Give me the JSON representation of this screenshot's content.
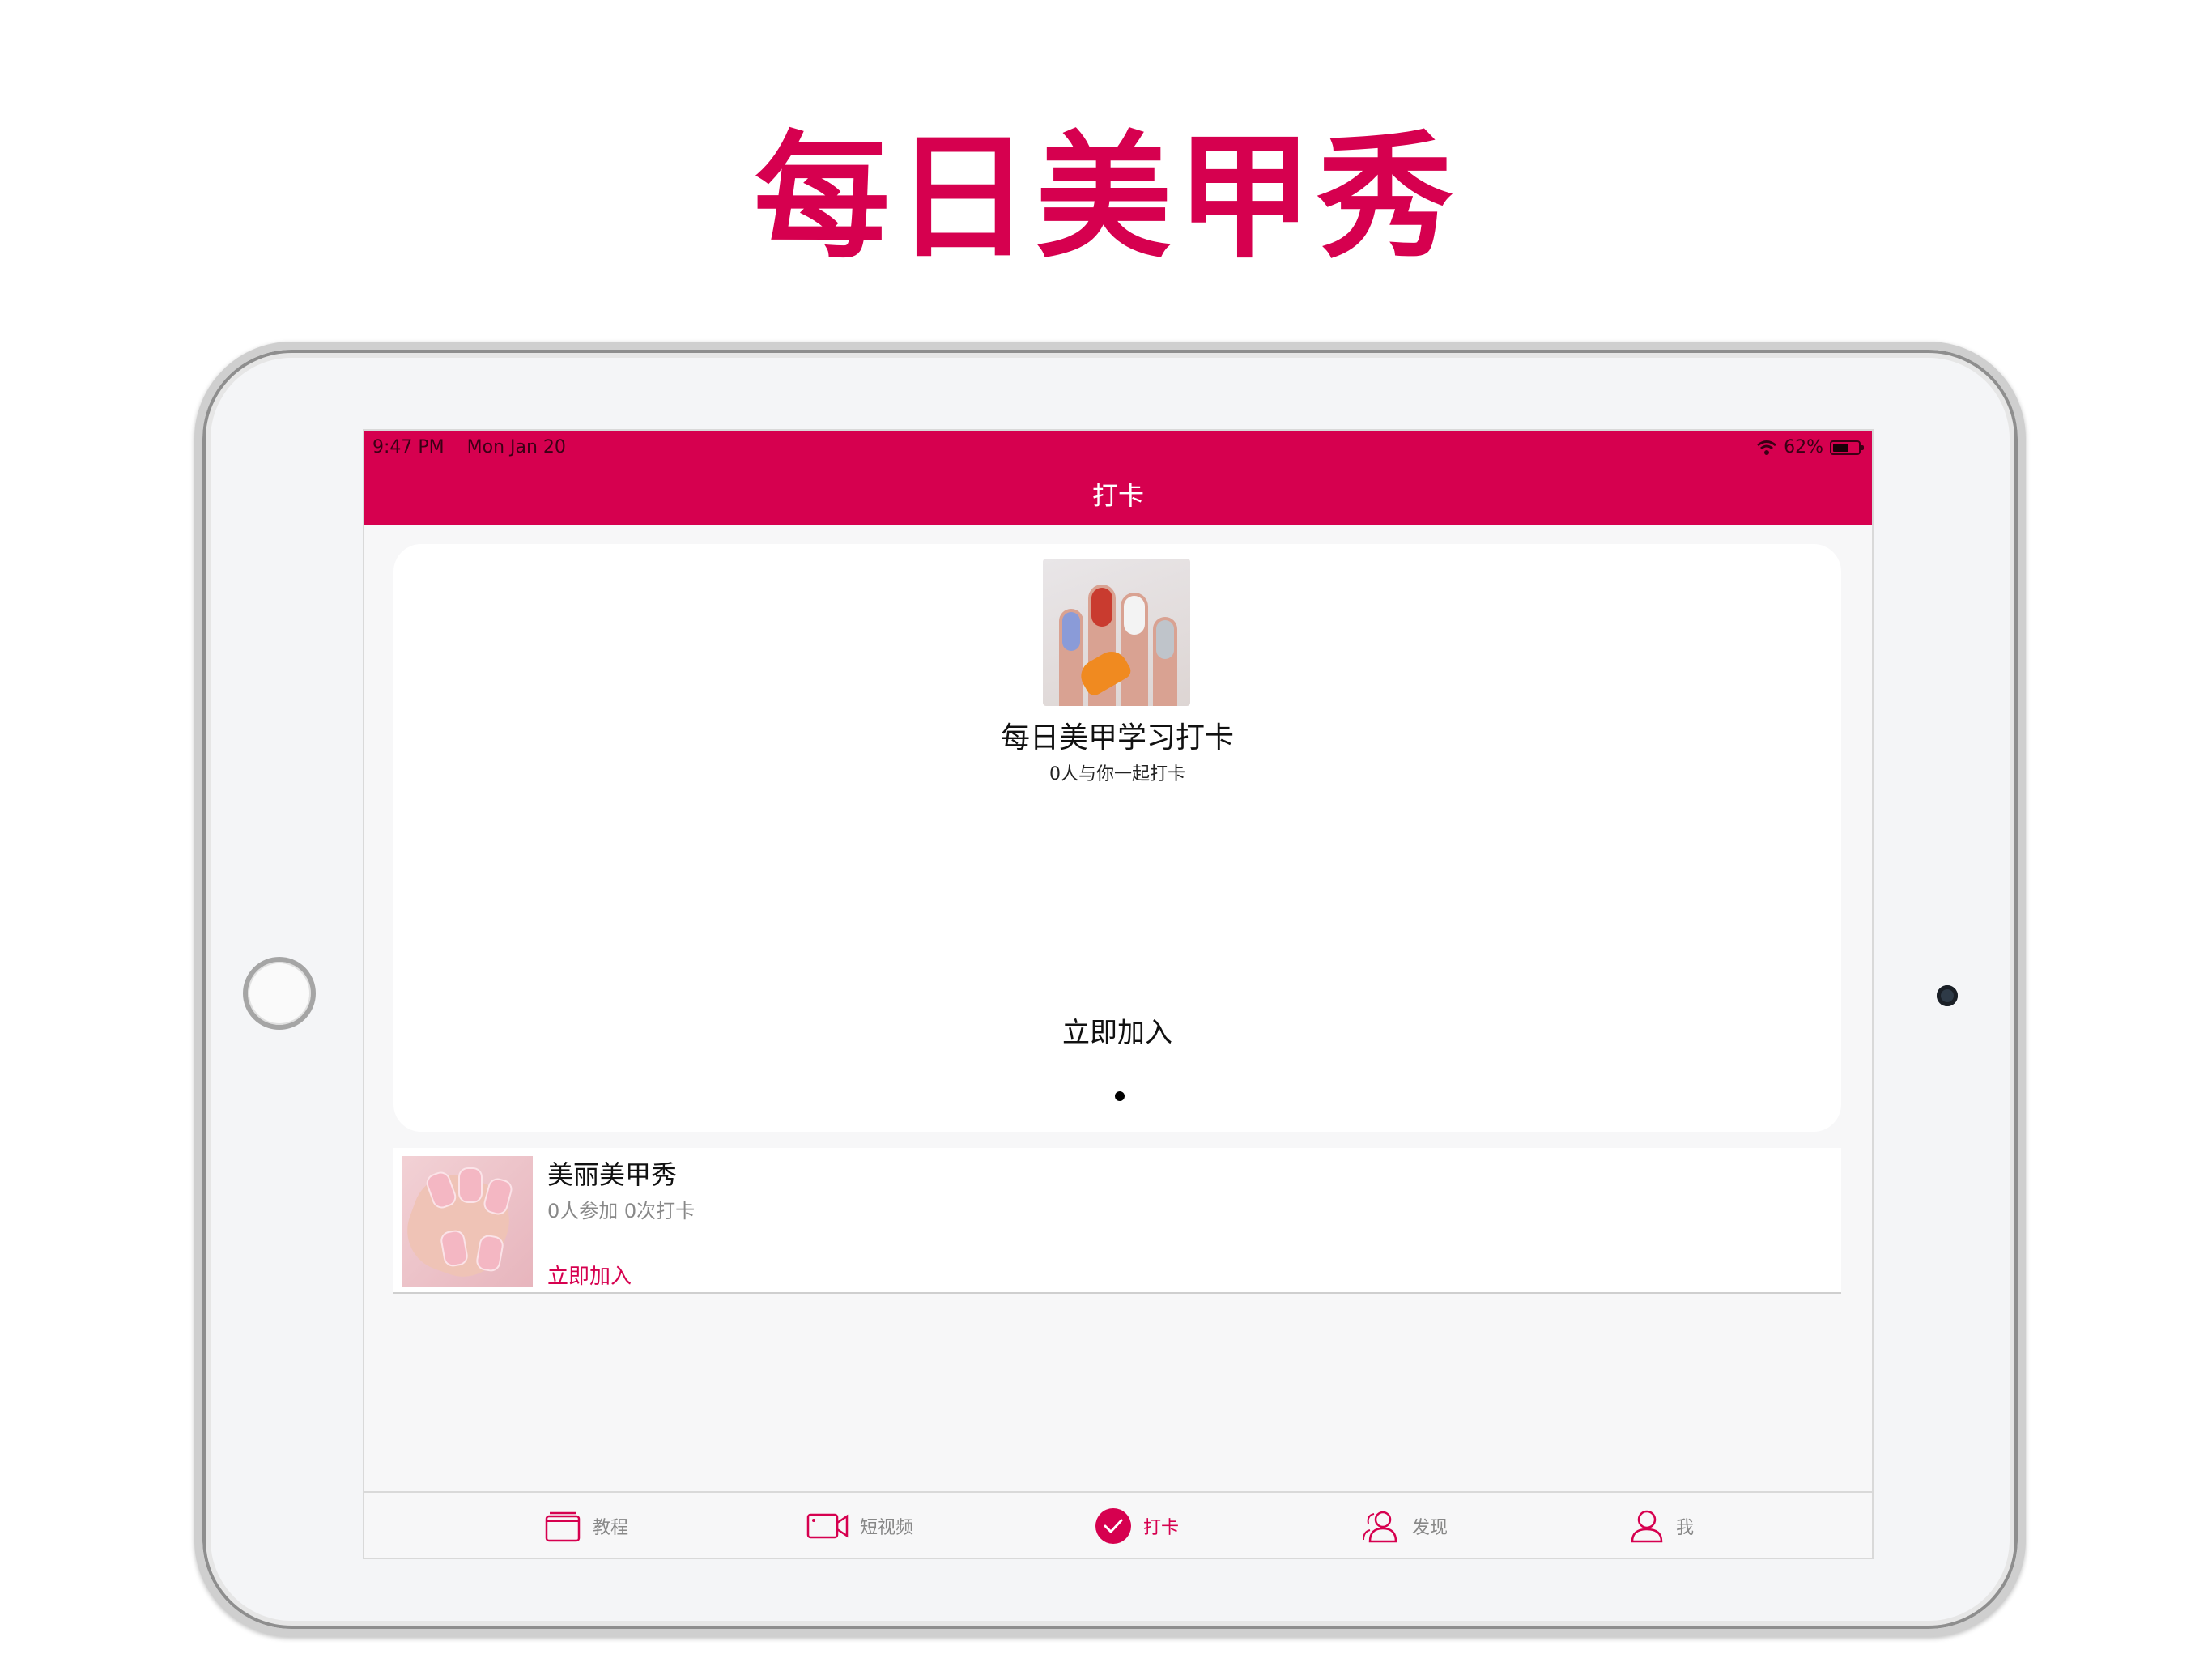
{
  "headline": "每日美甲秀",
  "status_bar": {
    "time": "9:47 PM",
    "date": "Mon Jan 20",
    "battery": "62%",
    "battery_level": 0.62
  },
  "nav": {
    "title": "打卡"
  },
  "hero": {
    "title": "每日美甲学习打卡",
    "subtitle": "0人与你一起打卡",
    "join": "立即加入"
  },
  "groups": [
    {
      "title": "美丽美甲秀",
      "stats": "0人参加 0次打卡",
      "join": "立即加入"
    }
  ],
  "tabs": [
    {
      "label": "教程",
      "icon": "book-icon"
    },
    {
      "label": "短视频",
      "icon": "video-camera-icon"
    },
    {
      "label": "打卡",
      "icon": "checkmark-circle-icon",
      "active": true
    },
    {
      "label": "发现",
      "icon": "people-icon"
    },
    {
      "label": "我",
      "icon": "user-icon"
    }
  ],
  "colors": {
    "brand": "#d6004f",
    "inactive": "#888888"
  }
}
